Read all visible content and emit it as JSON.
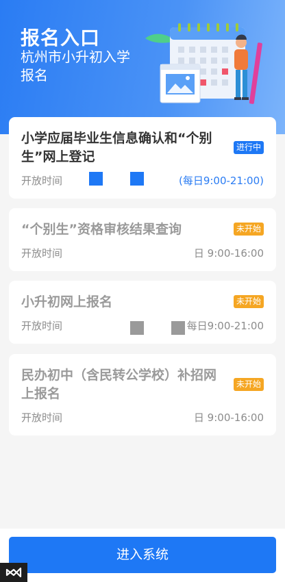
{
  "hero": {
    "title": "报名入口",
    "subtitle": "杭州市小升初入学报名"
  },
  "cards": [
    {
      "title": "小学应届毕业生信息确认和“个别生”网上登记",
      "badge": "进行中",
      "time_label": "开放时间",
      "time_value": "(每日9:00-21:00)",
      "status": "active"
    },
    {
      "title": "“个别生”资格审核结果查询",
      "badge": "未开始",
      "time_label": "开放时间",
      "time_value": "日 9:00-16:00",
      "status": "pending"
    },
    {
      "title": "小升初网上报名",
      "badge": "未开始",
      "time_label": "开放时间",
      "time_value": "每日9:00-21:00",
      "status": "pending"
    },
    {
      "title": "民办初中（含民转公学校）补招网上报名",
      "badge": "未开始",
      "time_label": "开放时间",
      "time_value": "日 9:00-16:00",
      "status": "pending"
    }
  ],
  "footer": {
    "enter_button": "进入系统"
  },
  "colors": {
    "primary": "#1e78f5",
    "pending": "#f5a623",
    "muted": "#9a9a9a"
  }
}
